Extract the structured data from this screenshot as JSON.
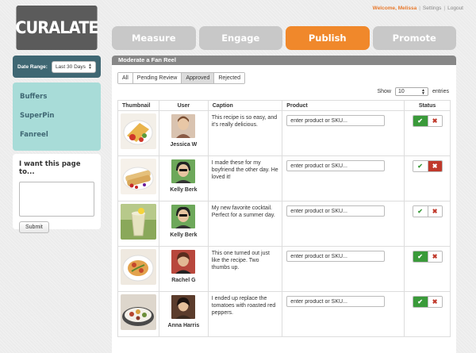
{
  "logo": {
    "text": "CURALATE"
  },
  "toplinks": {
    "welcome": "Welcome, Melissa",
    "settings": "Settings",
    "logout": "Logout"
  },
  "daterange": {
    "label": "Date Range:",
    "value": "Last 30 Days"
  },
  "sidenav": {
    "items": [
      "Buffers",
      "SuperPin",
      "Fanreel"
    ]
  },
  "feedback": {
    "title": "I want this page to...",
    "submit": "Submit"
  },
  "tabs": [
    {
      "label": "Measure",
      "active": false
    },
    {
      "label": "Engage",
      "active": false
    },
    {
      "label": "Publish",
      "active": true
    },
    {
      "label": "Promote",
      "active": false
    }
  ],
  "panel": {
    "title": "Moderate a Fan Reel"
  },
  "filters": [
    "All",
    "Pending Review",
    "Approved",
    "Rejected"
  ],
  "selected_filter": "Approved",
  "show": {
    "label": "Show",
    "value": "10",
    "suffix": "entries"
  },
  "table": {
    "columns": [
      "Thumbnail",
      "User",
      "Caption",
      "Product",
      "Status"
    ],
    "product_placeholder": "enter product or SKU...",
    "rows": [
      {
        "user": "Jessica W",
        "caption": "This recipe is so easy, and it's really delicious.",
        "status": "approved"
      },
      {
        "user": "Kelly Berk",
        "caption": "I made these for my boyfriend the other day. He loved it!",
        "status": "rejected"
      },
      {
        "user": "Kelly Berk",
        "caption": "My new favorite cocktail. Perfect for a summer day.",
        "status": "none"
      },
      {
        "user": "Rachel G",
        "caption": "This one turned out just like the recipe. Two thumbs up.",
        "status": "approved"
      },
      {
        "user": "Anna Harris",
        "caption": "I ended up replace the tomatoes with roasted red peppers.",
        "status": "approved"
      }
    ]
  },
  "colors": {
    "accent_orange": "#f0882b",
    "teal_dark": "#3f6773",
    "teal_light": "#a8dcd8",
    "approve_green": "#3a9a3a",
    "reject_red": "#c0392b"
  }
}
